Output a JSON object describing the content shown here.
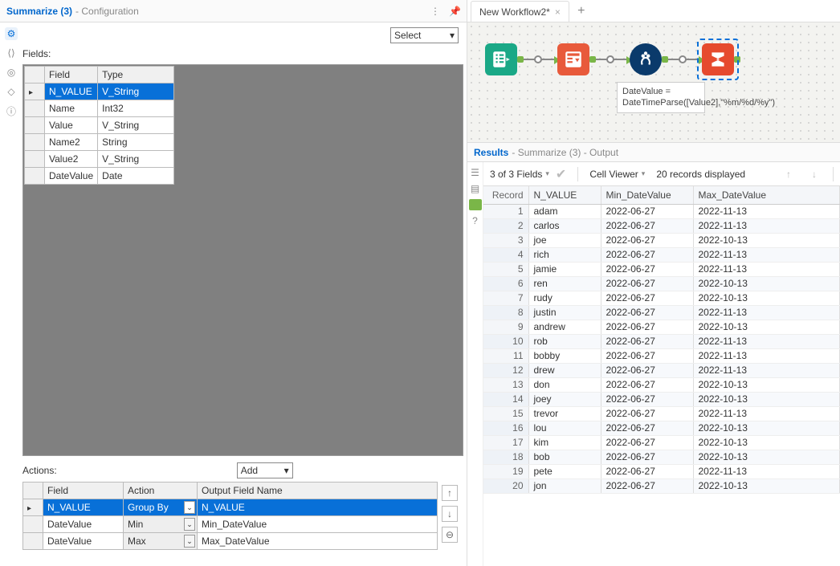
{
  "config": {
    "title": "Summarize (3)",
    "subtitle": "- Configuration",
    "fields_label": "Fields:",
    "select_label": "Select",
    "field_header": "Field",
    "type_header": "Type",
    "rows": [
      {
        "field": "N_VALUE",
        "type": "V_String",
        "selected": true
      },
      {
        "field": "Name",
        "type": "Int32"
      },
      {
        "field": "Value",
        "type": "V_String"
      },
      {
        "field": "Name2",
        "type": "String"
      },
      {
        "field": "Value2",
        "type": "V_String"
      },
      {
        "field": "DateValue",
        "type": "Date"
      }
    ],
    "actions_label": "Actions:",
    "add_label": "Add",
    "actions_headers": {
      "field": "Field",
      "action": "Action",
      "output": "Output Field Name"
    },
    "actions": [
      {
        "field": "N_VALUE",
        "action": "Group By",
        "output": "N_VALUE",
        "selected": true
      },
      {
        "field": "DateValue",
        "action": "Min",
        "output": "Min_DateValue"
      },
      {
        "field": "DateValue",
        "action": "Max",
        "output": "Max_DateValue"
      }
    ]
  },
  "tabs": {
    "active": "New Workflow2*"
  },
  "formula_note": "DateValue = DateTimeParse([Value2],\"%m/%d/%y\")",
  "results": {
    "title": "Results",
    "subtitle": "- Summarize (3) - Output",
    "fields_text": "3 of 3 Fields",
    "cellviewer": "Cell Viewer",
    "records_text": "20 records displayed",
    "headers": {
      "record": "Record",
      "n_value": "N_VALUE",
      "min": "Min_DateValue",
      "max": "Max_DateValue"
    },
    "rows": [
      {
        "i": 1,
        "n": "adam",
        "min": "2022-06-27",
        "max": "2022-11-13"
      },
      {
        "i": 2,
        "n": "carlos",
        "min": "2022-06-27",
        "max": "2022-11-13"
      },
      {
        "i": 3,
        "n": "joe",
        "min": "2022-06-27",
        "max": "2022-10-13"
      },
      {
        "i": 4,
        "n": "rich",
        "min": "2022-06-27",
        "max": "2022-11-13"
      },
      {
        "i": 5,
        "n": "jamie",
        "min": "2022-06-27",
        "max": "2022-11-13"
      },
      {
        "i": 6,
        "n": "ren",
        "min": "2022-06-27",
        "max": "2022-10-13"
      },
      {
        "i": 7,
        "n": "rudy",
        "min": "2022-06-27",
        "max": "2022-10-13"
      },
      {
        "i": 8,
        "n": "justin",
        "min": "2022-06-27",
        "max": "2022-11-13"
      },
      {
        "i": 9,
        "n": "andrew",
        "min": "2022-06-27",
        "max": "2022-10-13"
      },
      {
        "i": 10,
        "n": "rob",
        "min": "2022-06-27",
        "max": "2022-11-13"
      },
      {
        "i": 11,
        "n": "bobby",
        "min": "2022-06-27",
        "max": "2022-11-13"
      },
      {
        "i": 12,
        "n": "drew",
        "min": "2022-06-27",
        "max": "2022-11-13"
      },
      {
        "i": 13,
        "n": "don",
        "min": "2022-06-27",
        "max": "2022-10-13"
      },
      {
        "i": 14,
        "n": "joey",
        "min": "2022-06-27",
        "max": "2022-10-13"
      },
      {
        "i": 15,
        "n": "trevor",
        "min": "2022-06-27",
        "max": "2022-11-13"
      },
      {
        "i": 16,
        "n": "lou",
        "min": "2022-06-27",
        "max": "2022-10-13"
      },
      {
        "i": 17,
        "n": "kim",
        "min": "2022-06-27",
        "max": "2022-10-13"
      },
      {
        "i": 18,
        "n": "bob",
        "min": "2022-06-27",
        "max": "2022-10-13"
      },
      {
        "i": 19,
        "n": "pete",
        "min": "2022-06-27",
        "max": "2022-11-13"
      },
      {
        "i": 20,
        "n": "jon",
        "min": "2022-06-27",
        "max": "2022-10-13"
      }
    ]
  }
}
